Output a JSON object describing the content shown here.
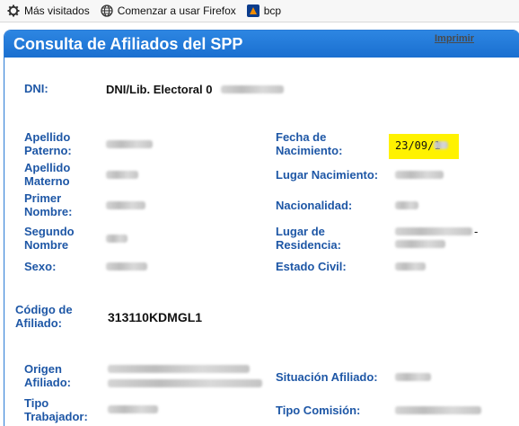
{
  "bookmarks": [
    {
      "label": "Más visitados",
      "icon": "gear-icon"
    },
    {
      "label": "Comenzar a usar Firefox",
      "icon": "globe-icon"
    },
    {
      "label": "bcp",
      "icon": "bcp-logo-icon"
    }
  ],
  "panel": {
    "title": "Consulta de Afiliados del SPP",
    "print_label": "Imprimir"
  },
  "fields": {
    "dni_label": "DNI:",
    "dni_value": "DNI/Lib. Electoral 0",
    "apellido_paterno_label_1": "Apellido",
    "apellido_paterno_label_2": "Paterno:",
    "apellido_materno_label_1": "Apellido",
    "apellido_materno_label_2": "Materno",
    "primer_nombre_label_1": "Primer",
    "primer_nombre_label_2": "Nombre:",
    "segundo_nombre_label_1": "Segundo",
    "segundo_nombre_label_2": "Nombre",
    "sexo_label": "Sexo:",
    "fecha_nac_label_1": "Fecha de",
    "fecha_nac_label_2": "Nacimiento:",
    "fecha_nac_value": "23/09/1",
    "lugar_nac_label": "Lugar Nacimiento:",
    "nacionalidad_label": "Nacionalidad:",
    "lugar_res_label_1": "Lugar de",
    "lugar_res_label_2": "Residencia:",
    "lugar_res_dash": "-",
    "estado_civil_label": "Estado Civil:",
    "codigo_label_1": "Código de",
    "codigo_label_2": "Afiliado:",
    "codigo_value": "313110KDMGL1",
    "origen_label_1": "Origen",
    "origen_label_2": "Afiliado:",
    "situacion_label": "Situación Afiliado:",
    "tipo_trab_label_1": "Tipo",
    "tipo_trab_label_2": "Trabajador:",
    "tipo_comision_label": "Tipo Comisión:"
  },
  "colors": {
    "header_blue": "#1a6fd0",
    "label_blue": "#1e57a6",
    "highlight_yellow": "#fff200"
  }
}
